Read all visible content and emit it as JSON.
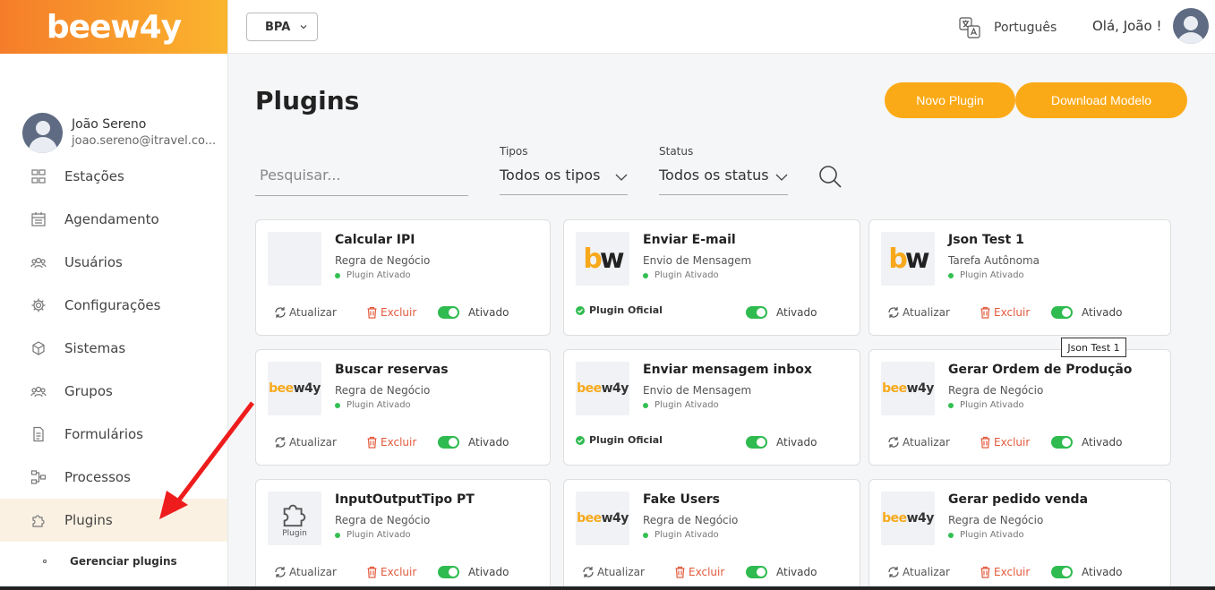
{
  "app": {
    "logo": "beew4y"
  },
  "profile": {
    "name": "João Sereno",
    "email": "joao.sereno@itravel.co..."
  },
  "nav": {
    "items": [
      {
        "label": "Estações",
        "icon": "stations-icon"
      },
      {
        "label": "Agendamento",
        "icon": "calendar-icon"
      },
      {
        "label": "Usuários",
        "icon": "users-icon"
      },
      {
        "label": "Configurações",
        "icon": "gear-icon"
      },
      {
        "label": "Sistemas",
        "icon": "cube-icon"
      },
      {
        "label": "Grupos",
        "icon": "group-icon"
      },
      {
        "label": "Formulários",
        "icon": "document-icon"
      },
      {
        "label": "Processos",
        "icon": "flow-icon"
      },
      {
        "label": "Plugins",
        "icon": "puzzle-icon",
        "active": true
      }
    ],
    "sub_item": "Gerenciar plugins"
  },
  "topbar": {
    "selector": "BPA",
    "language": "Português",
    "greeting": "Olá, João !"
  },
  "page": {
    "title": "Plugins",
    "new_button": "Novo Plugin",
    "download_button": "Download Modelo",
    "search_placeholder": "Pesquisar...",
    "filter_types_label": "Tipos",
    "filter_types_value": "Todos os tipos",
    "filter_status_label": "Status",
    "filter_status_value": "Todos os status"
  },
  "labels": {
    "update": "Atualizar",
    "delete": "Excluir",
    "enabled": "Ativado",
    "plugin_enabled": "Plugin Ativado",
    "official": "Plugin Oficial",
    "puzzle_caption": "Plugin"
  },
  "cards": [
    {
      "title": "Calcular IPI",
      "type": "Regra de Negócio",
      "logo": "blank",
      "official": false
    },
    {
      "title": "Enviar E-mail",
      "type": "Envio de Mensagem",
      "logo": "bw",
      "official": true
    },
    {
      "title": "Json Test 1",
      "type": "Tarefa Autônoma",
      "logo": "bw",
      "official": false
    },
    {
      "title": "Buscar reservas",
      "type": "Regra de Negócio",
      "logo": "beew4y",
      "official": false
    },
    {
      "title": "Enviar mensagem inbox",
      "type": "Envio de Mensagem",
      "logo": "beew4y",
      "official": true
    },
    {
      "title": "Gerar Ordem de Produção",
      "type": "Regra de Negócio",
      "logo": "beew4y",
      "official": false
    },
    {
      "title": "InputOutputTipo PT",
      "type": "Regra de Negócio",
      "logo": "puzzle",
      "official": false
    },
    {
      "title": "Fake Users",
      "type": "Regra de Negócio",
      "logo": "beew4y",
      "official": false
    },
    {
      "title": "Gerar pedido venda",
      "type": "Regra de Negócio",
      "logo": "beew4y",
      "official": false
    }
  ],
  "tooltip": "Json Test 1",
  "colors": {
    "accent": "#fbaa17",
    "toggle_on": "#2fbb4f",
    "delete": "#e25a3c",
    "active_nav_bg": "#fbf1e3"
  }
}
